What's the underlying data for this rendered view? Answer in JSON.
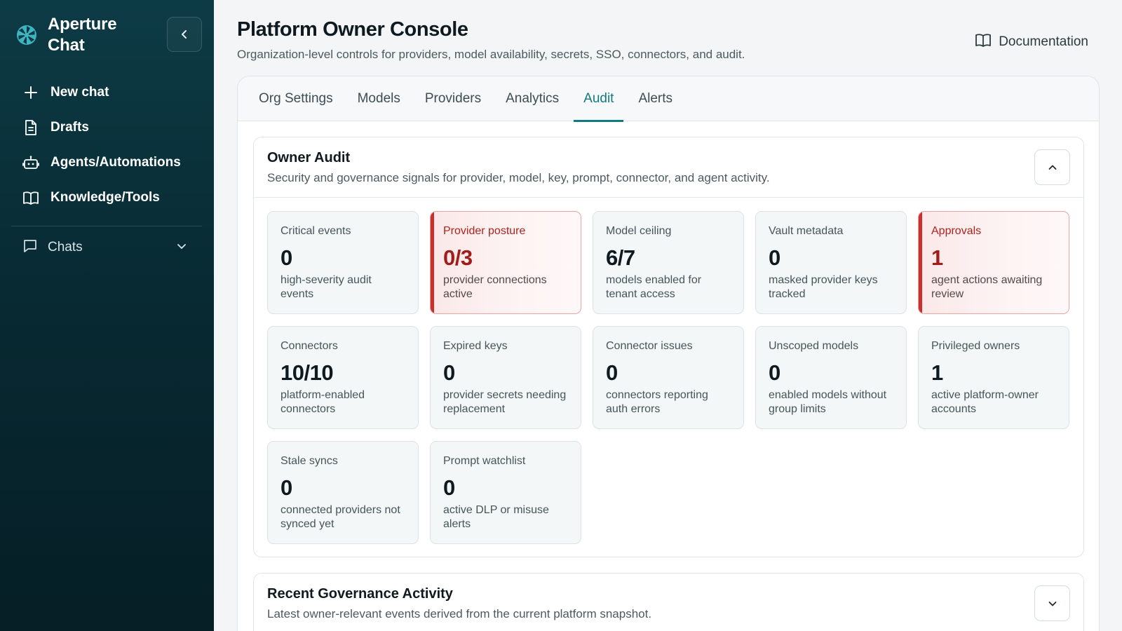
{
  "sidebar": {
    "brand": "Aperture Chat",
    "nav": [
      {
        "label": "New chat",
        "icon": "plus-icon"
      },
      {
        "label": "Drafts",
        "icon": "document-icon"
      },
      {
        "label": "Agents/Automations",
        "icon": "robot-icon"
      },
      {
        "label": "Knowledge/Tools",
        "icon": "book-icon"
      }
    ],
    "chats_label": "Chats"
  },
  "header": {
    "title": "Platform Owner Console",
    "subtitle": "Organization-level controls for providers, model availability, secrets, SSO, connectors, and audit.",
    "documentation_label": "Documentation"
  },
  "tabs": [
    {
      "label": "Org Settings",
      "active": false
    },
    {
      "label": "Models",
      "active": false
    },
    {
      "label": "Providers",
      "active": false
    },
    {
      "label": "Analytics",
      "active": false
    },
    {
      "label": "Audit",
      "active": true
    },
    {
      "label": "Alerts",
      "active": false
    }
  ],
  "audit": {
    "title": "Owner Audit",
    "subtitle": "Security and governance signals for provider, model, key, prompt, connector, and agent activity.",
    "cards": [
      {
        "label": "Critical events",
        "value": "0",
        "desc": "high-severity audit events",
        "alert": false
      },
      {
        "label": "Provider posture",
        "value": "0/3",
        "desc": "provider connections active",
        "alert": true
      },
      {
        "label": "Model ceiling",
        "value": "6/7",
        "desc": "models enabled for tenant access",
        "alert": false
      },
      {
        "label": "Vault metadata",
        "value": "0",
        "desc": "masked provider keys tracked",
        "alert": false
      },
      {
        "label": "Approvals",
        "value": "1",
        "desc": "agent actions awaiting review",
        "alert": true
      },
      {
        "label": "Connectors",
        "value": "10/10",
        "desc": "platform-enabled connectors",
        "alert": false
      },
      {
        "label": "Expired keys",
        "value": "0",
        "desc": "provider secrets needing replacement",
        "alert": false
      },
      {
        "label": "Connector issues",
        "value": "0",
        "desc": "connectors reporting auth errors",
        "alert": false
      },
      {
        "label": "Unscoped models",
        "value": "0",
        "desc": "enabled models without group limits",
        "alert": false
      },
      {
        "label": "Privileged owners",
        "value": "1",
        "desc": "active platform-owner accounts",
        "alert": false
      },
      {
        "label": "Stale syncs",
        "value": "0",
        "desc": "connected providers not synced yet",
        "alert": false
      },
      {
        "label": "Prompt watchlist",
        "value": "0",
        "desc": "active DLP or misuse alerts",
        "alert": false
      }
    ]
  },
  "activity": {
    "title": "Recent Governance Activity",
    "subtitle": "Latest owner-relevant events derived from the current platform snapshot."
  },
  "colors": {
    "accent": "#117a80",
    "alert": "#c9302c",
    "sidebar_bg": "#0a3039"
  }
}
